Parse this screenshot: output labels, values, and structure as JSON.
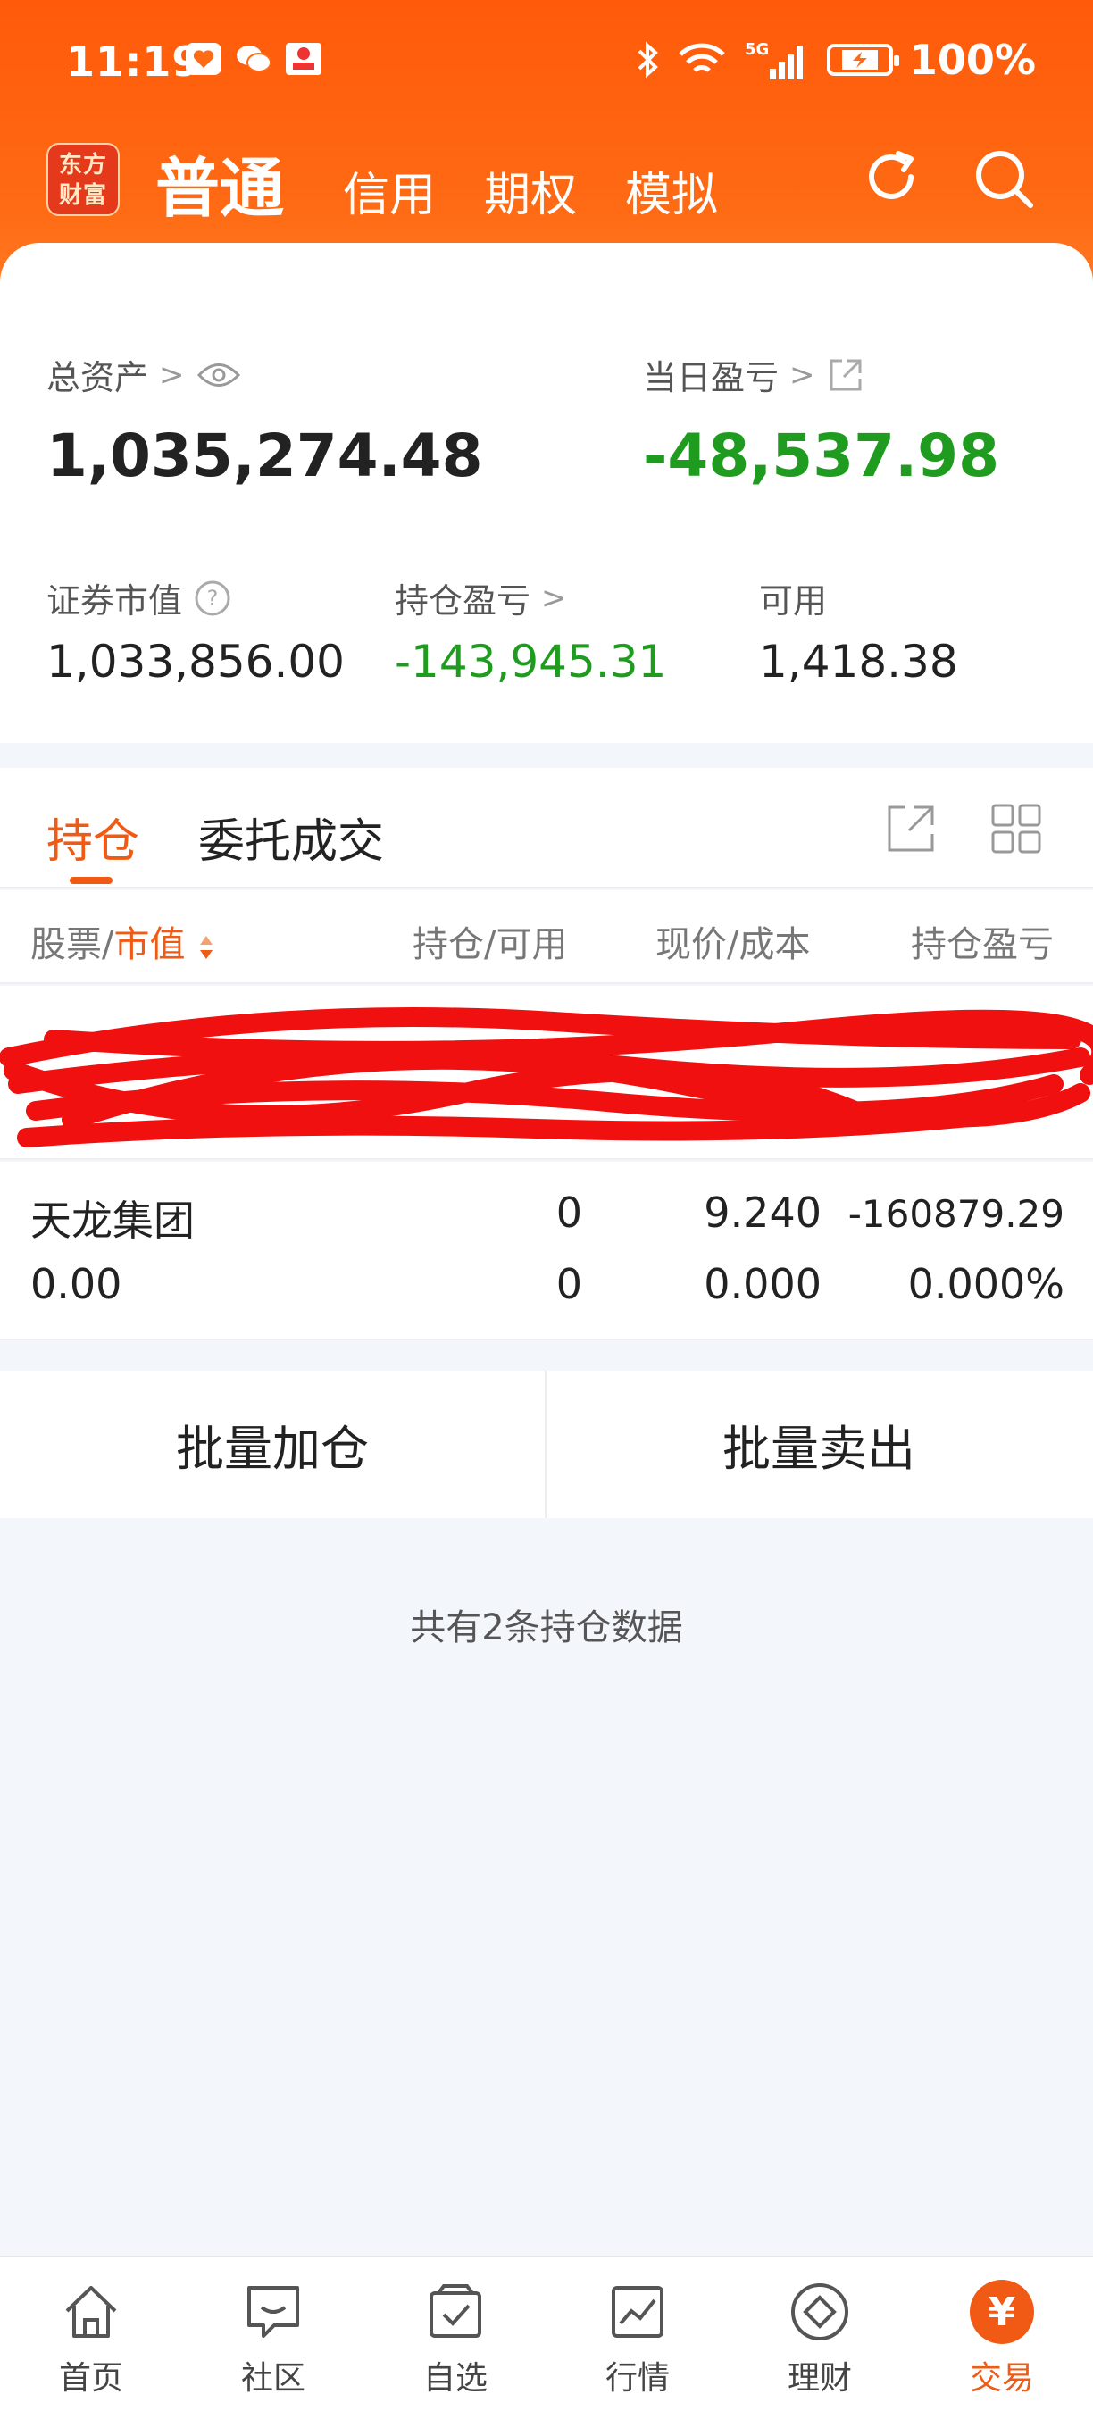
{
  "status": {
    "time": "11:19",
    "battery": "100%",
    "network": "5G"
  },
  "header": {
    "logo": [
      "东方",
      "财富"
    ],
    "main_tab": "普通",
    "tabs": [
      "信用",
      "期权",
      "模拟"
    ]
  },
  "summary": {
    "total_assets_label": "总资产",
    "total_assets": "1,035,274.48",
    "daily_pnl_label": "当日盈亏",
    "daily_pnl": "-48,537.98",
    "market_value_label": "证券市值",
    "market_value": "1,033,856.00",
    "position_pnl_label": "持仓盈亏",
    "position_pnl": "-143,945.31",
    "available_label": "可用",
    "available": "1,418.38"
  },
  "tabs": {
    "holdings": "持仓",
    "orders": "委托成交"
  },
  "table": {
    "headers": {
      "stock": "股票",
      "market_value": "市值",
      "shares": "持仓/可用",
      "price": "现价/成本",
      "pnl": "持仓盈亏"
    },
    "rows": [
      {
        "name": "天龙集团",
        "value": "0.00",
        "shares": "0",
        "available": "0",
        "price": "9.240",
        "cost": "0.000",
        "pnl": "-160879.29",
        "pnl_pct": "0.000%"
      }
    ]
  },
  "batch": {
    "add": "批量加仓",
    "sell": "批量卖出"
  },
  "count_text": "共有2条持仓数据",
  "bottom_nav": [
    {
      "label": "首页",
      "icon": "home-icon"
    },
    {
      "label": "社区",
      "icon": "community-icon"
    },
    {
      "label": "自选",
      "icon": "watchlist-icon"
    },
    {
      "label": "行情",
      "icon": "market-icon"
    },
    {
      "label": "理财",
      "icon": "wealth-icon"
    },
    {
      "label": "交易",
      "icon": "trade-icon",
      "active": true
    }
  ],
  "colors": {
    "brand": "#f05a14",
    "loss": "#1f9c1f"
  }
}
